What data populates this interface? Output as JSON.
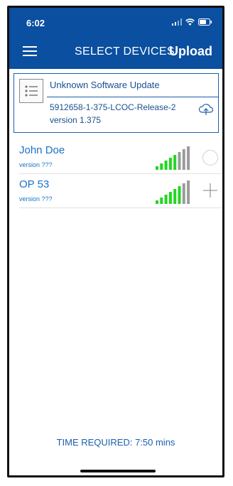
{
  "status_bar": {
    "time": "6:02",
    "icons": [
      "cellular-signal-icon",
      "wifi-icon",
      "battery-icon"
    ]
  },
  "navbar": {
    "menu_icon": "hamburger-menu-icon",
    "title": "SELECT DEVICES",
    "action": "Upload",
    "background": "#0a4fa0"
  },
  "update": {
    "icon": "list-document-icon",
    "title": "Unknown Software Update",
    "file": "5912658-1-375-LCOC-Release-2",
    "version": "version 1.375",
    "action_icon": "cloud-upload-icon"
  },
  "devices": [
    {
      "name": "John Doe",
      "version": "version ???",
      "signal_bars_active": 5,
      "signal_bars_total": 8,
      "control": "radio-empty"
    },
    {
      "name": "OP 53",
      "version": "version ???",
      "signal_bars_active": 6,
      "signal_bars_total": 8,
      "control": "plus-icon"
    }
  ],
  "footer": {
    "time_required": "TIME REQUIRED: 7:50 mins"
  },
  "colors": {
    "accent": "#1a73c8",
    "signal_active": "#22d622",
    "signal_inactive": "#9a9a9a"
  }
}
